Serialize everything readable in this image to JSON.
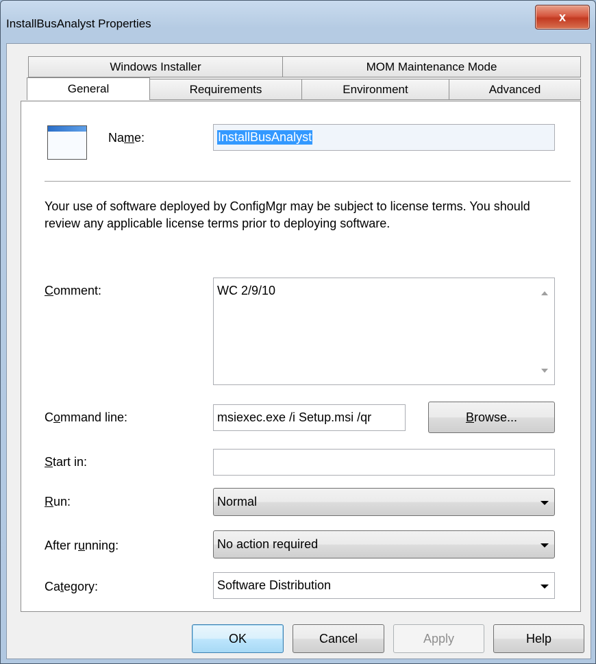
{
  "window": {
    "title": "InstallBusAnalyst Properties",
    "close_glyph": "x"
  },
  "tabs": {
    "row1": [
      "Windows Installer",
      "MOM Maintenance Mode"
    ],
    "row2": [
      "General",
      "Requirements",
      "Environment",
      "Advanced"
    ],
    "selected": "General"
  },
  "general": {
    "name_label_pre": "Na",
    "name_label_u": "m",
    "name_label_post": "e:",
    "name_value": "InstallBusAnalyst",
    "license_text": "Your use of software deployed by ConfigMgr may be subject to license terms. You should review any applicable license terms prior to deploying software.",
    "comment_label_u": "C",
    "comment_label_post": "omment:",
    "comment_value": "WC 2/9/10",
    "command_label_pre": "C",
    "command_label_u": "o",
    "command_label_post": "mmand line:",
    "command_value": "msiexec.exe /i Setup.msi /qr",
    "browse_u": "B",
    "browse_post": "rowse...",
    "startin_label_u": "S",
    "startin_label_post": "tart in:",
    "startin_value": "",
    "run_label_u": "R",
    "run_label_post": "un:",
    "run_value": "Normal",
    "after_label_pre": "After r",
    "after_label_u": "u",
    "after_label_post": "nning:",
    "after_value": "No action required",
    "category_label_pre": "Ca",
    "category_label_u": "t",
    "category_label_post": "egory:",
    "category_value": "Software Distribution"
  },
  "buttons": {
    "ok": "OK",
    "cancel": "Cancel",
    "apply": "Apply",
    "help": "Help"
  },
  "icons": {
    "app": "application-window-icon",
    "close": "close-icon",
    "dropdown": "chevron-down-icon"
  }
}
